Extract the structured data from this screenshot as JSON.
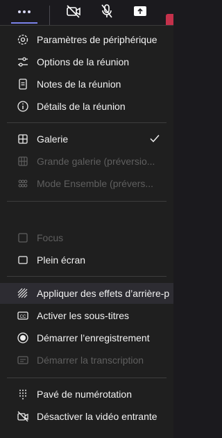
{
  "toolbar": {
    "more_icon": "more-dots-icon",
    "camera_icon": "video-off-icon",
    "mic_icon": "mic-off-icon",
    "share_icon": "share-tray-icon",
    "accent": "#7b83eb",
    "leave_color": "#c4314b"
  },
  "menu": {
    "items": [
      {
        "label": "Paramètres de périphérique",
        "icon": "gear-icon",
        "enabled": true
      },
      {
        "label": "Options de la réunion",
        "icon": "sliders-icon",
        "enabled": true
      },
      {
        "label": "Notes de la réunion",
        "icon": "notes-icon",
        "enabled": true
      },
      {
        "label": "Détails de la réunion",
        "icon": "info-icon",
        "enabled": true
      },
      {
        "label": "Galerie",
        "icon": "grid-icon",
        "enabled": true,
        "checked": true
      },
      {
        "label": "Grande galerie (préversio...",
        "icon": "large-grid-icon",
        "enabled": false
      },
      {
        "label": "Mode Ensemble (prévers...",
        "icon": "together-mode-icon",
        "enabled": false
      },
      {
        "label": "Focus",
        "icon": "focus-icon",
        "enabled": false
      },
      {
        "label": "Plein écran",
        "icon": "fullscreen-icon",
        "enabled": true
      },
      {
        "label": "Appliquer des effets d’arrière-p",
        "icon": "background-effects-icon",
        "enabled": true,
        "highlighted": true
      },
      {
        "label": "Activer les sous-titres",
        "icon": "captions-icon",
        "enabled": true
      },
      {
        "label": "Démarrer l’enregistrement",
        "icon": "record-icon",
        "enabled": true
      },
      {
        "label": "Démarrer la transcription",
        "icon": "transcript-icon",
        "enabled": false
      },
      {
        "label": "Pavé de numérotation",
        "icon": "dialpad-icon",
        "enabled": true
      },
      {
        "label": "Désactiver la vidéo entrante",
        "icon": "video-incoming-off-icon",
        "enabled": true
      }
    ]
  }
}
